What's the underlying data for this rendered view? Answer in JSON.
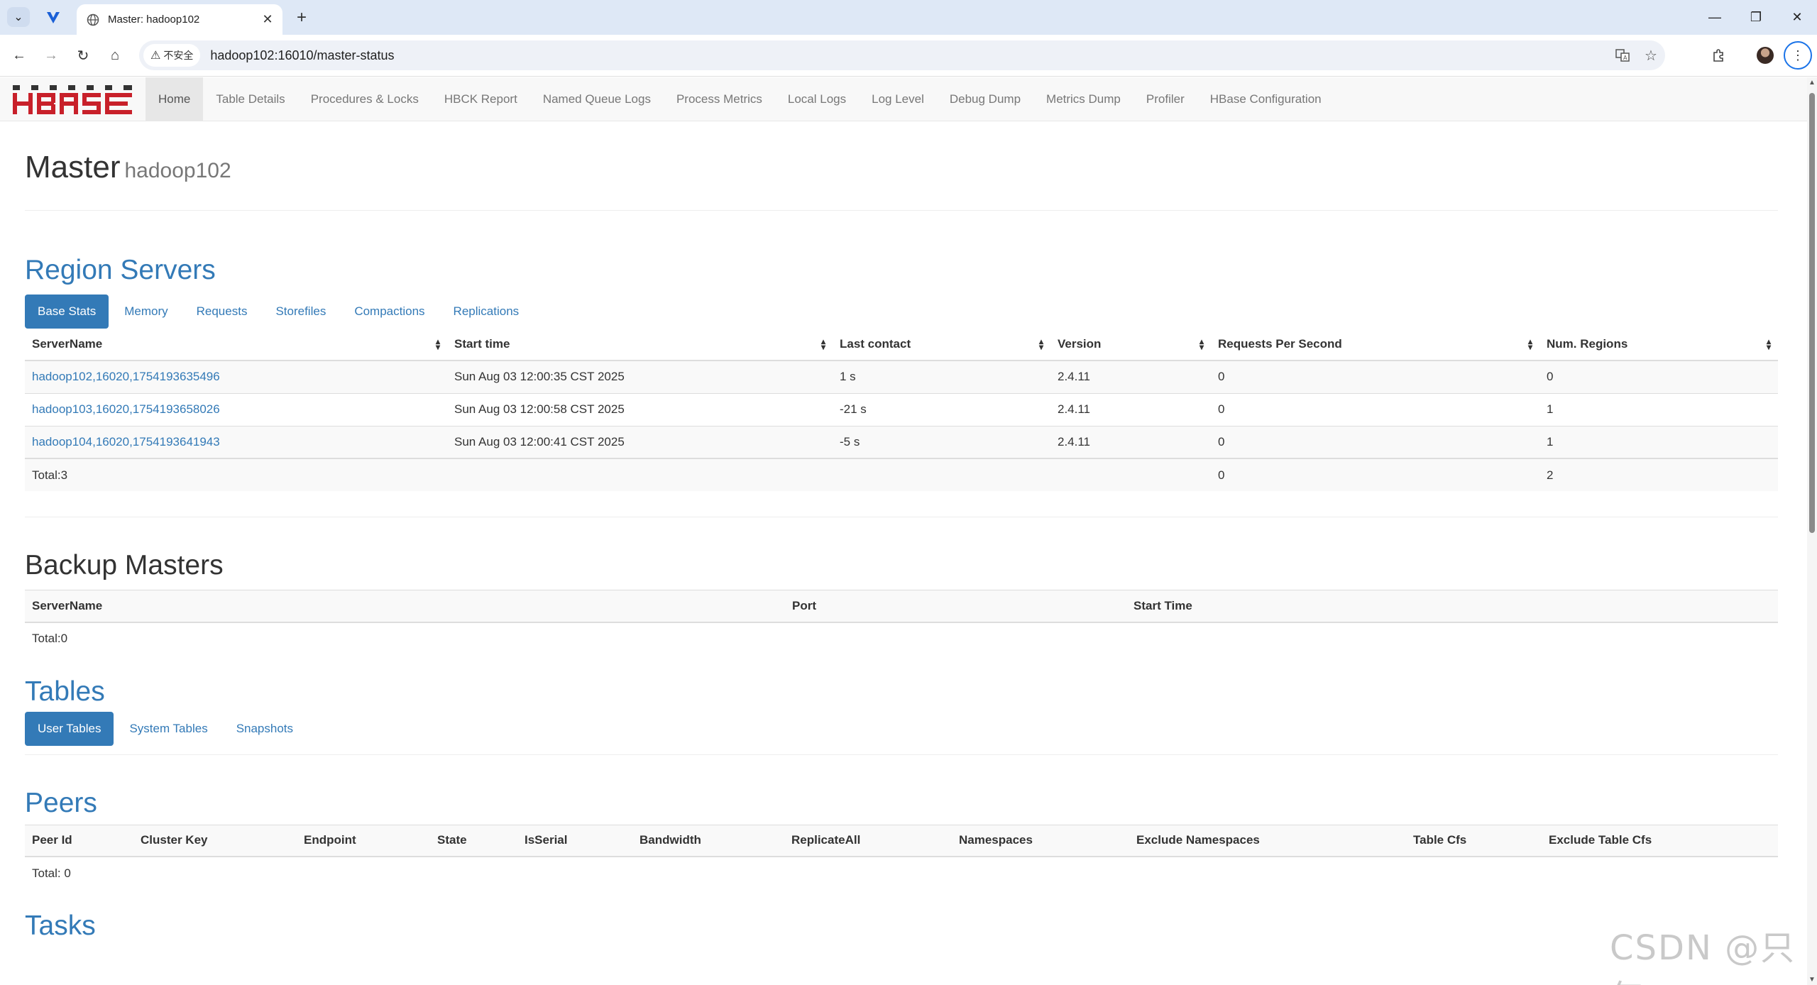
{
  "browser": {
    "tab_title": "Master: hadoop102",
    "security_label": "不安全",
    "url": "hadoop102:16010/master-status"
  },
  "nav": {
    "items": [
      {
        "label": "Home"
      },
      {
        "label": "Table Details"
      },
      {
        "label": "Procedures & Locks"
      },
      {
        "label": "HBCK Report"
      },
      {
        "label": "Named Queue Logs"
      },
      {
        "label": "Process Metrics"
      },
      {
        "label": "Local Logs"
      },
      {
        "label": "Log Level"
      },
      {
        "label": "Debug Dump"
      },
      {
        "label": "Metrics Dump"
      },
      {
        "label": "Profiler"
      },
      {
        "label": "HBase Configuration"
      }
    ],
    "active_index": 0
  },
  "header": {
    "title": "Master",
    "host": "hadoop102"
  },
  "region_servers": {
    "title": "Region Servers",
    "tabs": [
      "Base Stats",
      "Memory",
      "Requests",
      "Storefiles",
      "Compactions",
      "Replications"
    ],
    "columns": [
      "ServerName",
      "Start time",
      "Last contact",
      "Version",
      "Requests Per Second",
      "Num. Regions"
    ],
    "rows": [
      [
        "hadoop102,16020,1754193635496",
        "Sun Aug 03 12:00:35 CST 2025",
        "1 s",
        "2.4.11",
        "0",
        "0"
      ],
      [
        "hadoop103,16020,1754193658026",
        "Sun Aug 03 12:00:58 CST 2025",
        "-21 s",
        "2.4.11",
        "0",
        "1"
      ],
      [
        "hadoop104,16020,1754193641943",
        "Sun Aug 03 12:00:41 CST 2025",
        "-5 s",
        "2.4.11",
        "0",
        "1"
      ]
    ],
    "total": {
      "label": "Total:3",
      "requests": "0",
      "regions": "2"
    }
  },
  "backup_masters": {
    "title": "Backup Masters",
    "columns": [
      "ServerName",
      "Port",
      "Start Time"
    ],
    "total": "Total:0"
  },
  "tables": {
    "title": "Tables",
    "tabs": [
      "User Tables",
      "System Tables",
      "Snapshots"
    ]
  },
  "peers": {
    "title": "Peers",
    "columns": [
      "Peer Id",
      "Cluster Key",
      "Endpoint",
      "State",
      "IsSerial",
      "Bandwidth",
      "ReplicateAll",
      "Namespaces",
      "Exclude Namespaces",
      "Table Cfs",
      "Exclude Table Cfs"
    ],
    "total": "Total: 0"
  },
  "tasks": {
    "title": "Tasks"
  },
  "watermark": "CSDN @只年",
  "colors": {
    "link": "#337ab7",
    "navbar_bg": "#f8f8f8",
    "logo_red": "#c8202a"
  }
}
